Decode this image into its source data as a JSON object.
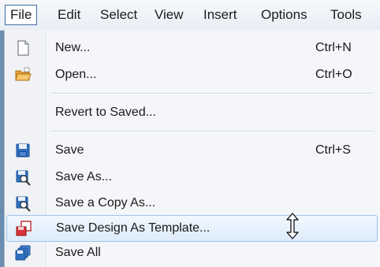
{
  "menubar": {
    "items": [
      {
        "label": "File",
        "icon": ""
      },
      {
        "label": "Edit"
      },
      {
        "label": "Select"
      },
      {
        "label": "View"
      },
      {
        "label": "Insert"
      },
      {
        "label": "Options"
      },
      {
        "label": "Tools"
      }
    ],
    "active": "File"
  },
  "file_menu": {
    "items": [
      {
        "label": "New...",
        "shortcut": "Ctrl+N",
        "icon": "new-document-icon"
      },
      {
        "label": "Open...",
        "shortcut": "Ctrl+O",
        "icon": "open-folder-icon"
      },
      {
        "label": "Revert to Saved...",
        "shortcut": "",
        "icon": ""
      },
      {
        "label": "Save",
        "shortcut": "Ctrl+S",
        "icon": "floppy-disk-icon"
      },
      {
        "label": "Save As...",
        "shortcut": "",
        "icon": "save-as-icon"
      },
      {
        "label": "Save a Copy As...",
        "shortcut": "",
        "icon": "save-copy-icon"
      },
      {
        "label": "Save Design As Template...",
        "shortcut": "",
        "icon": "save-template-icon",
        "highlighted": true
      },
      {
        "label": "Save All",
        "shortcut": "",
        "icon": "save-all-icon"
      }
    ]
  },
  "colors": {
    "highlight_border": "#9ec3ea",
    "highlight_fill": "#dcebfb",
    "menubar_active_border": "#3f6aa6",
    "backdrop": "#6a8db0"
  },
  "cursor": {
    "type": "resize-vertical-cursor"
  }
}
